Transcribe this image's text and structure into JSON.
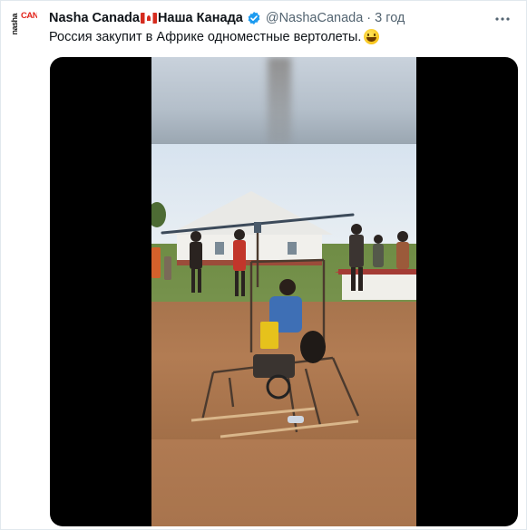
{
  "tweet": {
    "author_name": "Nasha Canada",
    "author_name_ru": "Наша Канада",
    "handle": "@NashaCanada",
    "separator": "·",
    "time": "3 год",
    "text": "Россия закупит в Африке одноместные вертолеты.",
    "emoji": "grinning-face-emoji"
  },
  "avatar": {
    "small_text": "nasha",
    "big_text": "CANADA",
    "brand_color": "#e2231a"
  },
  "colors": {
    "text_primary": "#0f1419",
    "text_secondary": "#536471",
    "verified_blue": "#1d9bf0",
    "media_background": "#000000"
  },
  "media": {
    "type": "video"
  }
}
